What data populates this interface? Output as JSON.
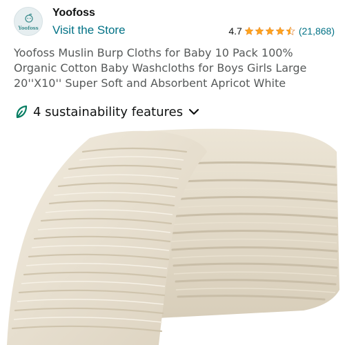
{
  "store": {
    "logo_text": "Yoofoss",
    "name": "Yoofoss",
    "visit_label": "Visit the Store"
  },
  "rating": {
    "value": "4.7",
    "stars": 4.5,
    "count": "(21,868)"
  },
  "product": {
    "title": "Yoofoss Muslin Burp Cloths for Baby 10 Pack 100% Organic Cotton Baby Washcloths for Boys Girls Large 20''X10'' Super Soft and Absorbent Apricot White"
  },
  "sustainability": {
    "label": "4 sustainability features",
    "icon": "leaf-icon",
    "expand_icon": "chevron-down-icon"
  },
  "image": {
    "subject": "folded-muslin-cloths"
  },
  "colors": {
    "link": "#007185",
    "star": "#ffa41c",
    "text": "#0f1111",
    "muted": "#565959",
    "leaf": "#067d62"
  }
}
